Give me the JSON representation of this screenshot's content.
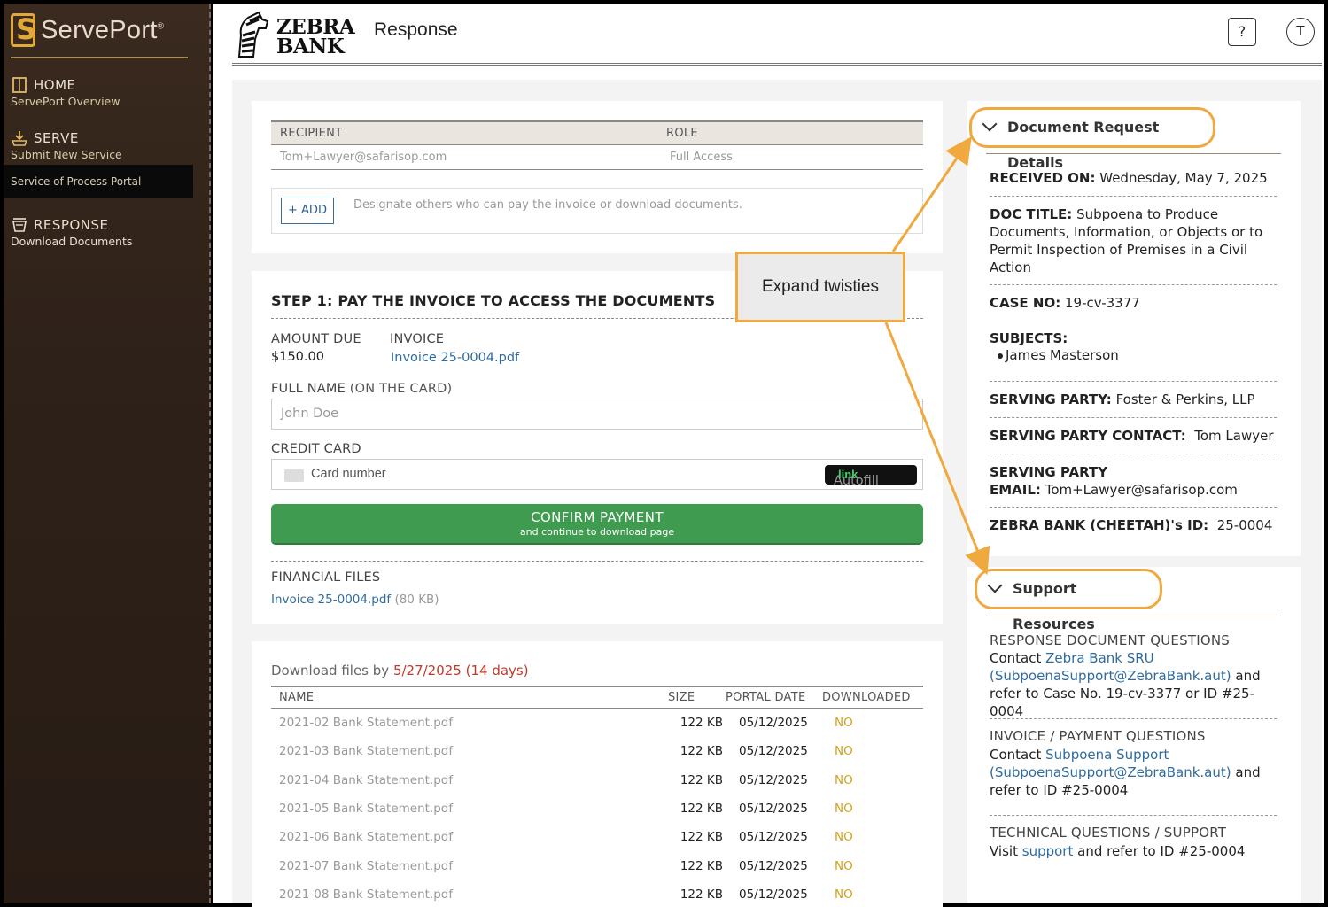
{
  "sidebar": {
    "brand": "ServePort",
    "brand_mark": "®",
    "items": [
      {
        "title": "HOME",
        "sub": "ServePort Overview",
        "icon": "book-icon"
      },
      {
        "title": "SERVE",
        "sub": "Submit New Service",
        "icon": "serve-icon"
      },
      {
        "title": "RESPONSE",
        "sub": "Download Documents",
        "icon": "basket-icon"
      }
    ],
    "active_sub": "Service of Process Portal"
  },
  "header": {
    "bank_line1": "ZEBRA",
    "bank_line2": "BANK",
    "page_title": "Response",
    "help": "?",
    "user_initial": "T"
  },
  "recipients": {
    "col_recipient": "RECIPIENT",
    "col_role": "ROLE",
    "rows": [
      {
        "recipient": "Tom+Lawyer@safarisop.com",
        "role": "Full Access"
      }
    ],
    "add_label": "+ ADD",
    "add_note": "Designate others who can pay the invoice or download documents."
  },
  "step1": {
    "title": "STEP 1: PAY THE INVOICE TO ACCESS THE DOCUMENTS",
    "amount_label": "AMOUNT DUE",
    "amount": "$150.00",
    "invoice_label": "INVOICE",
    "invoice_link": "Invoice 25-0004.pdf",
    "fullname_label": "FULL NAME",
    "fullname_hint": "(ON THE CARD)",
    "fullname_placeholder": "John Doe",
    "credit_label": "CREDIT CARD",
    "card_placeholder": "Card number",
    "autofill": "Autofill",
    "autofill_link": "link",
    "confirm": "CONFIRM PAYMENT",
    "confirm_sub": "and continue to download page",
    "fin_label": "FINANCIAL FILES",
    "fin_file": "Invoice 25-0004.pdf",
    "fin_size": "(80 KB)"
  },
  "downloads": {
    "prefix": "Download files by",
    "deadline": "5/27/2025 (14 days)",
    "cols": [
      "NAME",
      "SIZE",
      "PORTAL DATE",
      "DOWNLOADED"
    ],
    "rows": [
      {
        "name": "2021-02 Bank Statement.pdf",
        "size": "122 KB",
        "date": "05/12/2025",
        "dl": "NO"
      },
      {
        "name": "2021-03 Bank Statement.pdf",
        "size": "122 KB",
        "date": "05/12/2025",
        "dl": "NO"
      },
      {
        "name": "2021-04 Bank Statement.pdf",
        "size": "122 KB",
        "date": "05/12/2025",
        "dl": "NO"
      },
      {
        "name": "2021-05 Bank Statement.pdf",
        "size": "122 KB",
        "date": "05/12/2025",
        "dl": "NO"
      },
      {
        "name": "2021-06 Bank Statement.pdf",
        "size": "122 KB",
        "date": "05/12/2025",
        "dl": "NO"
      },
      {
        "name": "2021-07 Bank Statement.pdf",
        "size": "122 KB",
        "date": "05/12/2025",
        "dl": "NO"
      },
      {
        "name": "2021-08 Bank Statement.pdf",
        "size": "122 KB",
        "date": "05/12/2025",
        "dl": "NO"
      }
    ]
  },
  "details": {
    "title": "Document Request Details",
    "received_label": "RECEIVED ON:",
    "received": "Wednesday, May 7, 2025",
    "doc_label": "DOC TITLE:",
    "doc_l1": "Subpoena to Produce",
    "doc_l2": "Documents, Information, or Objects or to",
    "doc_l3": "Permit Inspection of Premises in a Civil",
    "doc_l4": "Action",
    "case_label": "CASE NO:",
    "case": "19-cv-3377",
    "subjects_label": "SUBJECTS:",
    "subject": "James Masterson",
    "party_label": "SERVING PARTY:",
    "party": "Foster & Perkins, LLP",
    "contact_label": "SERVING PARTY CONTACT:",
    "contact": "Tom Lawyer",
    "email_label1": "SERVING PARTY",
    "email_label2": "EMAIL:",
    "email": "Tom+Lawyer@safarisop.com",
    "id_label": "ZEBRA BANK (CHEETAH)'s ID:",
    "id": "25-0004"
  },
  "support": {
    "title": "Support Resources",
    "q1_title": "RESPONSE DOCUMENT QUESTIONS",
    "q1_pre": "Contact",
    "q1_link": "Zebra Bank SRU",
    "q1_email": "(SubpoenaSupport@ZebraBank.aut)",
    "q1_and": "and",
    "q1_tail": "refer to Case No. 19-cv-3377 or ID #25-0004",
    "q2_title": "INVOICE / PAYMENT QUESTIONS",
    "q2_pre": "Contact",
    "q2_link": "Subpoena Support",
    "q2_email": "(SubpoenaSupport@ZebraBank.aut)",
    "q2_and": "and",
    "q2_tail": "refer to ID #25-0004",
    "q3_title": "TECHNICAL QUESTIONS / SUPPORT",
    "q3_pre": "Visit",
    "q3_link": "support",
    "q3_tail": "and refer to ID #25-0004"
  },
  "annotation": {
    "text": "Expand twisties",
    "color": "#f0a93e"
  }
}
